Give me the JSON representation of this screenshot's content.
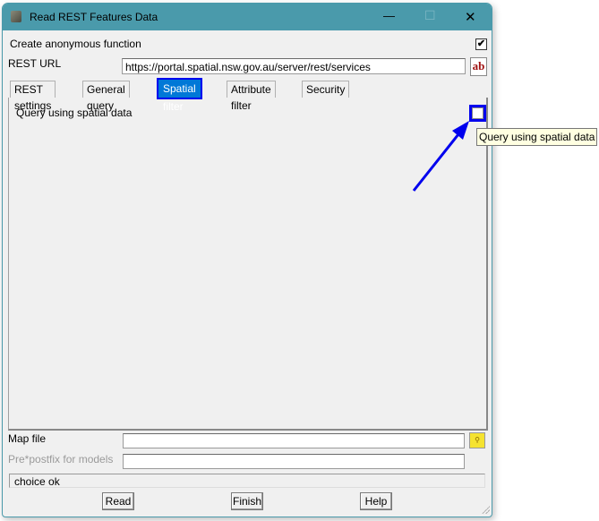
{
  "window": {
    "title": "Read REST Features Data",
    "minimize": "—",
    "maximize": "☐",
    "close": "✕"
  },
  "create_anonymous": {
    "label": "Create anonymous function",
    "checked": true
  },
  "rest_url": {
    "label": "REST URL",
    "value": "https://portal.spatial.nsw.gov.au/server/rest/services",
    "ab_button": "ab"
  },
  "tabs": [
    {
      "label": "REST settings"
    },
    {
      "label": "General query"
    },
    {
      "label": "Spatial filter",
      "active": true
    },
    {
      "label": "Attribute filter"
    },
    {
      "label": "Security"
    }
  ],
  "spatial_filter": {
    "query_label": "Query using spatial data",
    "checked": false,
    "tooltip": "Query using spatial data"
  },
  "map_file": {
    "label": "Map file",
    "value": ""
  },
  "prefix": {
    "label": "Pre*postfix for models",
    "value": ""
  },
  "status": "choice ok",
  "buttons": {
    "read": "Read",
    "finish": "Finish",
    "help": "Help"
  },
  "colors": {
    "titlebar": "#4a9aab",
    "highlight": "#0000ee",
    "tab_active": "#0078d7"
  }
}
